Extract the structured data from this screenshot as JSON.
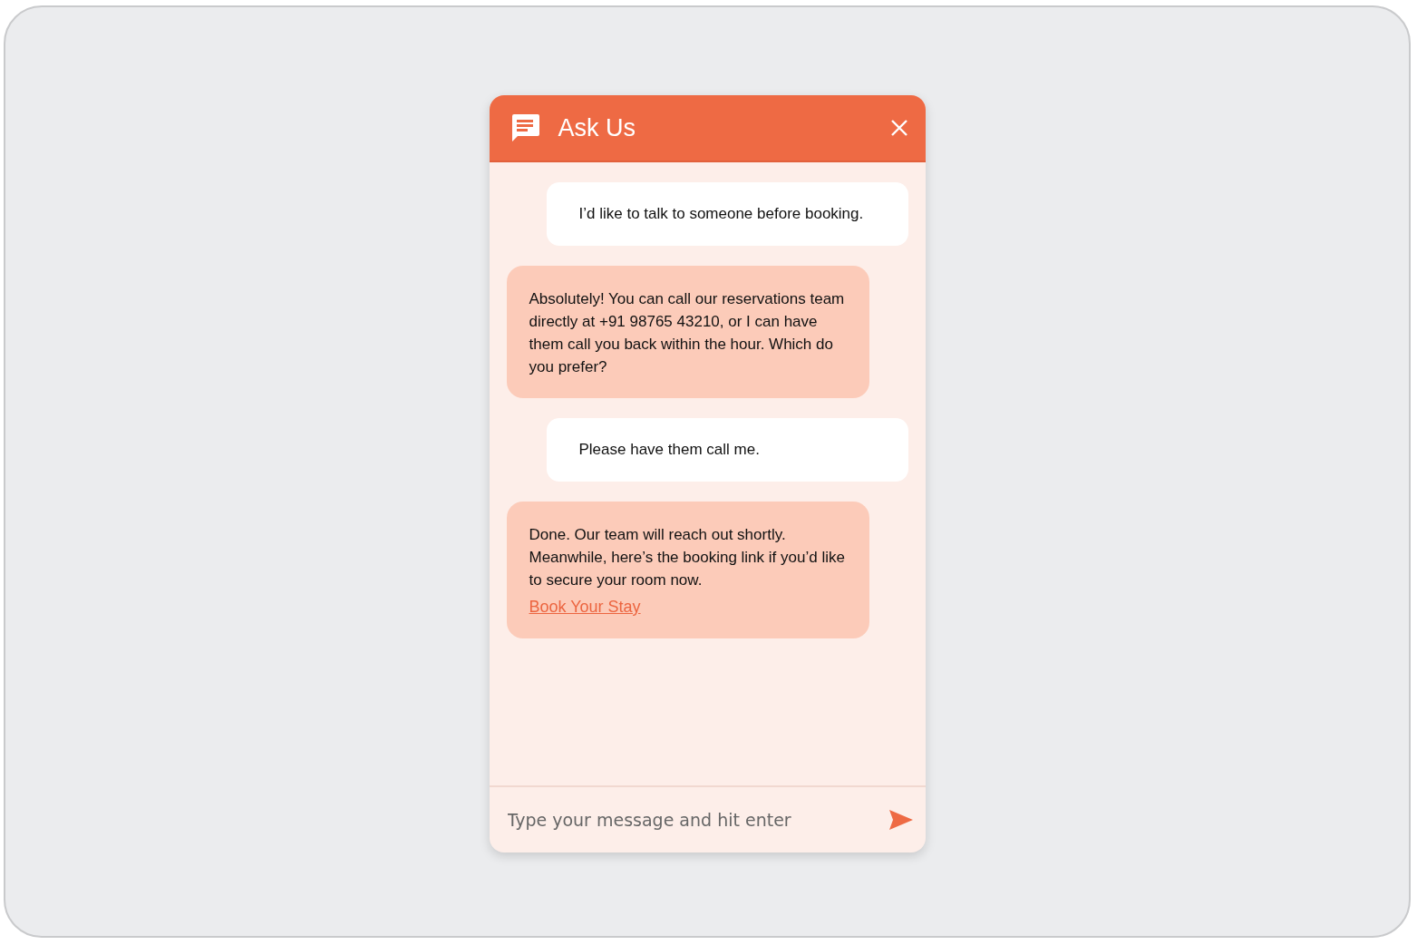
{
  "header": {
    "title": "Ask Us"
  },
  "messages": [
    {
      "kind": "user",
      "text": "I’d like to talk to someone before booking."
    },
    {
      "kind": "bot",
      "text": "Absolutely! You can call our reservations team directly at +91 98765 43210, or I can have them call you back within the hour. Which do you prefer?"
    },
    {
      "kind": "user",
      "text": "Please have them call me."
    },
    {
      "kind": "bot",
      "text": "Done. Our team will reach out shortly. Meanwhile, here’s the booking link if you’d like to secure your room now.",
      "link": "Book Your Stay"
    }
  ],
  "composer": {
    "placeholder": "Type your message and hit enter"
  }
}
